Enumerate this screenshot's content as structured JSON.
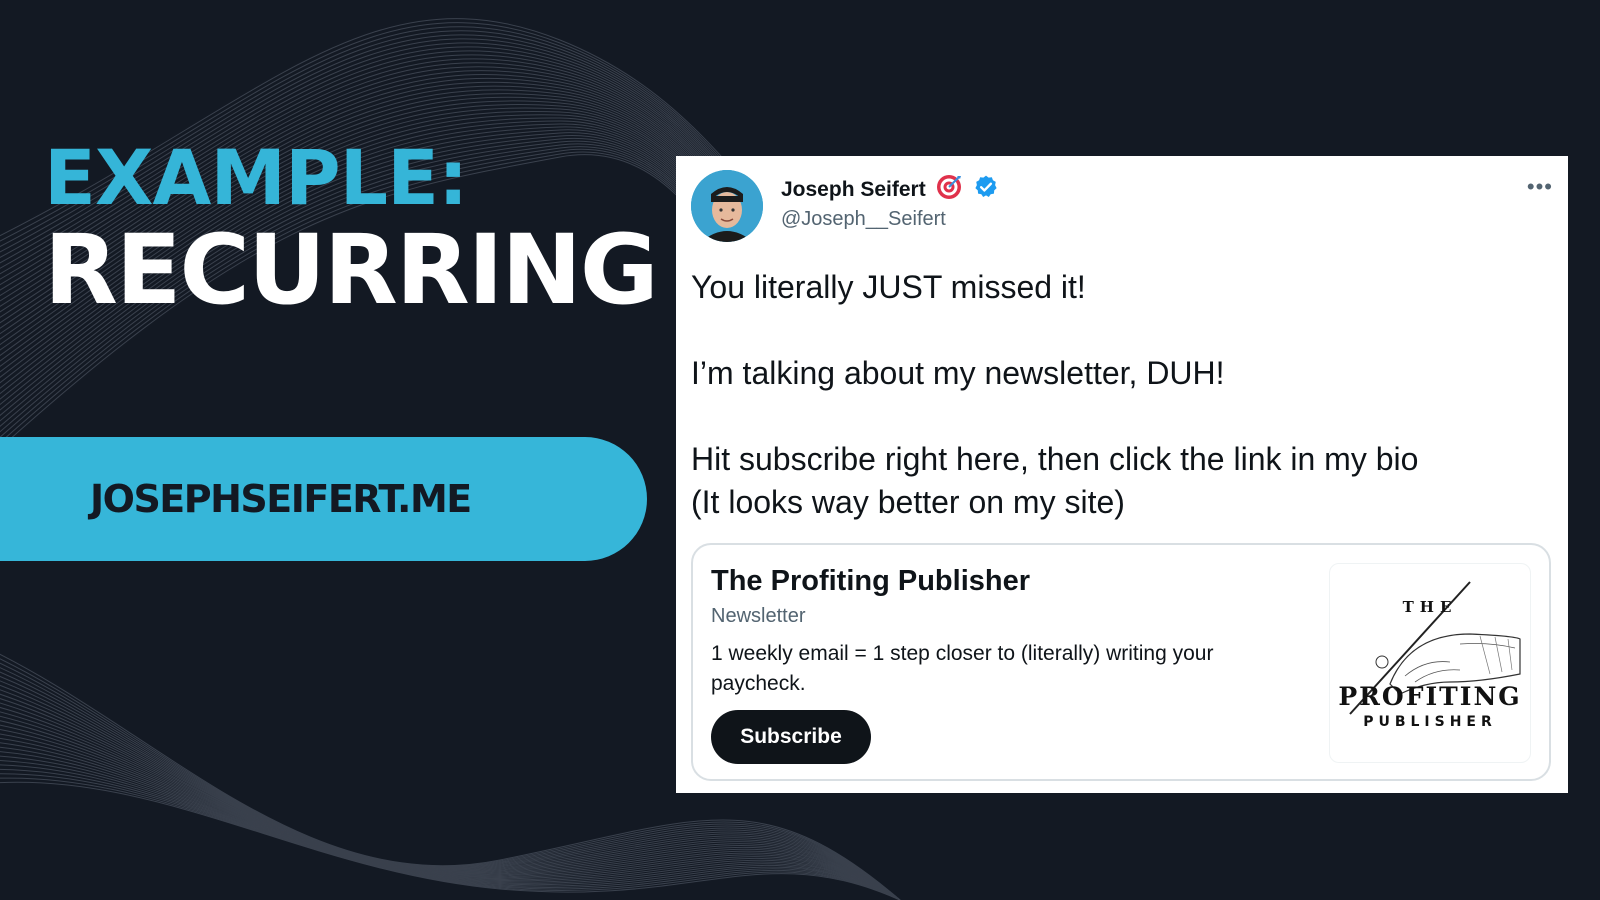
{
  "slide": {
    "headline_line1": "EXAMPLE:",
    "headline_line2": "RECURRING",
    "site_link": "JOSEPHSEIFERT.ME",
    "accent_color": "#35b5d8",
    "background_color": "#131923"
  },
  "tweet": {
    "author_name": "Joseph Seifert",
    "author_emoji": "target-emoji-icon",
    "verified_icon": "verified-badge-icon",
    "handle": "@Joseph__Seifert",
    "more_icon": "more-options-icon",
    "text_lines": [
      "You literally JUST missed it!",
      "I’m talking about my newsletter, DUH!",
      "Hit subscribe right here, then click the link in my bio",
      "(It looks way better on my site)"
    ],
    "card": {
      "title": "The Profiting Publisher",
      "subtitle": "Newsletter",
      "description": "1 weekly email = 1 step closer to (literally) writing your paycheck.",
      "button_label": "Subscribe",
      "logo": {
        "line1": "THE",
        "line2": "PROFITING",
        "line3": "PUBLISHER"
      }
    }
  }
}
